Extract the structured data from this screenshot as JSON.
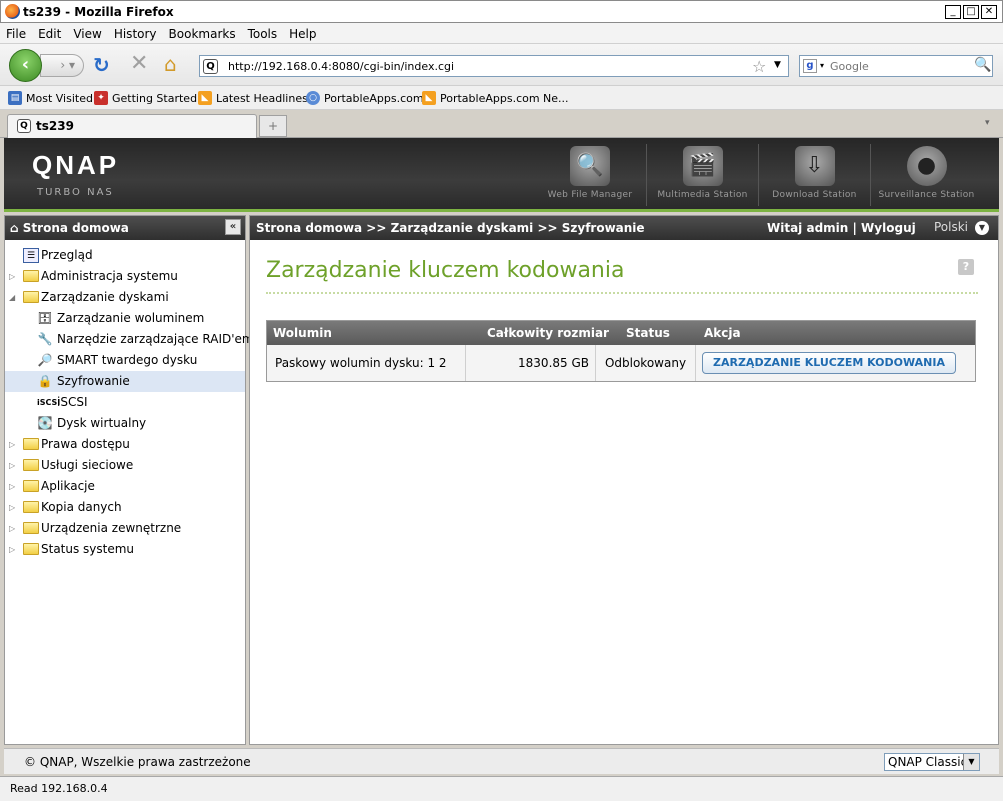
{
  "window": {
    "title": "ts239 - Mozilla Firefox"
  },
  "menu": [
    "File",
    "Edit",
    "View",
    "History",
    "Bookmarks",
    "Tools",
    "Help"
  ],
  "nav": {
    "url": "http://192.168.0.4:8080/cgi-bin/index.cgi",
    "search_placeholder": "Google"
  },
  "bookmarks": [
    "Most Visited",
    "Getting Started",
    "Latest Headlines",
    "PortableApps.com",
    "PortableApps.com Ne..."
  ],
  "tab": {
    "title": "ts239"
  },
  "header": {
    "logo": "QNAP",
    "subtitle": "Turbo NAS",
    "apps": [
      "Web File Manager",
      "Multimedia Station",
      "Download Station",
      "Surveillance Station"
    ]
  },
  "sidebar": {
    "title": "Strona domowa",
    "items": [
      {
        "label": "Przegląd"
      },
      {
        "label": "Administracja systemu"
      },
      {
        "label": "Zarządzanie dyskami"
      },
      {
        "label": "Zarządzanie woluminem"
      },
      {
        "label": "Narzędzie zarządzające RAID'em"
      },
      {
        "label": "SMART twardego dysku"
      },
      {
        "label": "Szyfrowanie"
      },
      {
        "label": "iSCSI"
      },
      {
        "label": "Dysk wirtualny"
      },
      {
        "label": "Prawa dostępu"
      },
      {
        "label": "Usługi sieciowe"
      },
      {
        "label": "Aplikacje"
      },
      {
        "label": "Kopia danych"
      },
      {
        "label": "Urządzenia zewnętrzne"
      },
      {
        "label": "Status systemu"
      }
    ]
  },
  "main": {
    "breadcrumb": "Strona domowa >> Zarządzanie dyskami >> Szyfrowanie",
    "welcome": "Witaj admin | Wyloguj",
    "language": "Polski",
    "page_title": "Zarządzanie kluczem kodowania",
    "table": {
      "headers": [
        "Wolumin",
        "Całkowity rozmiar",
        "Status",
        "Akcja"
      ],
      "rows": [
        {
          "volume": "Paskowy wolumin dysku: 1 2",
          "size": "1830.85 GB",
          "status": "Odblokowany",
          "action": "ZARZĄDZANIE KLUCZEM KODOWANIA"
        }
      ]
    }
  },
  "footer": {
    "copyright": "© QNAP, Wszelkie prawa zastrzeżone",
    "theme": "QNAP Classic"
  },
  "statusbar": {
    "text": "Read 192.168.0.4"
  },
  "colors": {
    "accent_green": "#6ea12a",
    "header_dark": "#2f2f2f",
    "button_text": "#1f6bb0"
  }
}
